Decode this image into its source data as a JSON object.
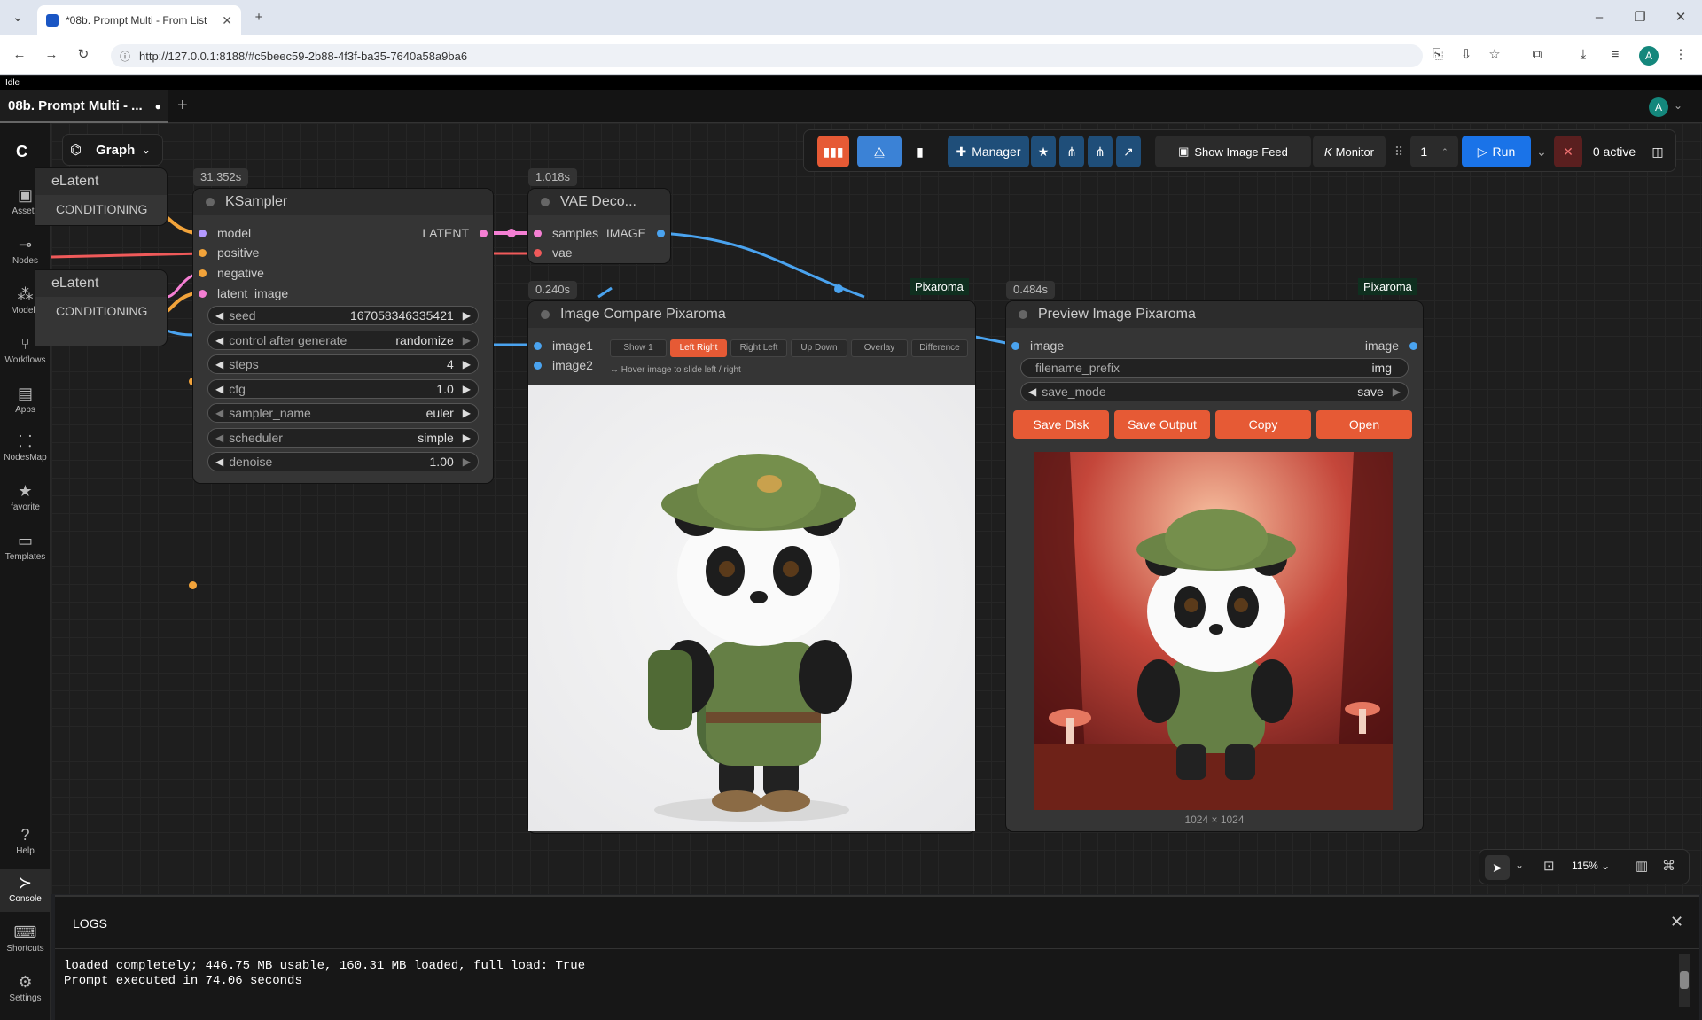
{
  "browser": {
    "tab_title": "*08b. Prompt Multi - From List",
    "url": "http://127.0.0.1:8188/#c5beec59-2b88-4f3f-ba35-7640a58a9ba6",
    "new_tab": "+",
    "profile_initial": "A"
  },
  "app": {
    "status": "Idle",
    "workflow_tab": "08b. Prompt Multi - ...",
    "new_workflow": "+",
    "user_initial": "A",
    "graph_label": "Graph"
  },
  "sidebar": {
    "items": [
      {
        "label": "Assets",
        "icon": "assets-icon"
      },
      {
        "label": "Nodes",
        "icon": "nodes-icon"
      },
      {
        "label": "Models",
        "icon": "models-icon"
      },
      {
        "label": "Workflows",
        "icon": "workflows-icon"
      },
      {
        "label": "Apps",
        "icon": "apps-icon"
      },
      {
        "label": "NodesMap",
        "icon": "nodesmap-icon"
      },
      {
        "label": "favorite",
        "icon": "star-icon"
      },
      {
        "label": "Templates",
        "icon": "templates-icon"
      }
    ],
    "bottom": [
      {
        "label": "Help",
        "icon": "help-icon"
      },
      {
        "label": "Console",
        "icon": "console-icon"
      },
      {
        "label": "Shortcuts",
        "icon": "keyboard-icon"
      },
      {
        "label": "Settings",
        "icon": "gear-icon"
      }
    ]
  },
  "toolbar": {
    "manager": "Manager",
    "show_image_feed": "Show Image Feed",
    "monitor": "Monitor",
    "queue_count": "1",
    "run": "Run",
    "active": "0 active"
  },
  "nodes": {
    "latent1": {
      "title": "eLatent",
      "output": "CONDITIONING"
    },
    "latent2": {
      "title": "eLatent",
      "output": "CONDITIONING"
    },
    "ksampler": {
      "timing": "31.352s",
      "title": "KSampler",
      "inputs": [
        "model",
        "positive",
        "negative",
        "latent_image"
      ],
      "output": "LATENT",
      "widgets": [
        {
          "label": "seed",
          "value": "167058346335421"
        },
        {
          "label": "control after generate",
          "value": "randomize"
        },
        {
          "label": "steps",
          "value": "4"
        },
        {
          "label": "cfg",
          "value": "1.0"
        },
        {
          "label": "sampler_name",
          "value": "euler"
        },
        {
          "label": "scheduler",
          "value": "simple"
        },
        {
          "label": "denoise",
          "value": "1.00"
        }
      ]
    },
    "vae": {
      "timing": "1.018s",
      "title": "VAE Deco...",
      "inputs": [
        "samples",
        "vae"
      ],
      "output": "IMAGE"
    },
    "compare": {
      "timing": "0.240s",
      "badge": "Pixaroma",
      "title": "Image Compare Pixaroma",
      "inputs": [
        "image1",
        "image2"
      ],
      "modes": [
        "Show 1",
        "Left Right",
        "Right Left",
        "Up Down",
        "Overlay",
        "Difference"
      ],
      "active_mode": "Left Right",
      "hint": "Hover image to slide left / right"
    },
    "preview": {
      "timing": "0.484s",
      "badge": "Pixaroma",
      "title": "Preview Image Pixaroma",
      "input": "image",
      "output": "image",
      "filename_prefix_label": "filename_prefix",
      "filename_prefix_value": "img",
      "save_mode_label": "save_mode",
      "save_mode_value": "save",
      "buttons": [
        "Save Disk",
        "Save Output",
        "Copy",
        "Open"
      ],
      "dimensions": "1024 × 1024"
    }
  },
  "zoom": {
    "level": "115%"
  },
  "logs": {
    "title": "LOGS",
    "lines": [
      "loaded completely; 446.75 MB usable, 160.31 MB loaded, full load: True",
      "Prompt executed in 74.06 seconds"
    ]
  },
  "colors": {
    "accent_orange": "#e65a35",
    "run_blue": "#1a73e8",
    "manager_blue": "#1f4e79",
    "link_blue": "#4aa3ef",
    "link_orange": "#f2a33a",
    "link_pink": "#f47fd3",
    "link_red": "#f05a5a"
  }
}
